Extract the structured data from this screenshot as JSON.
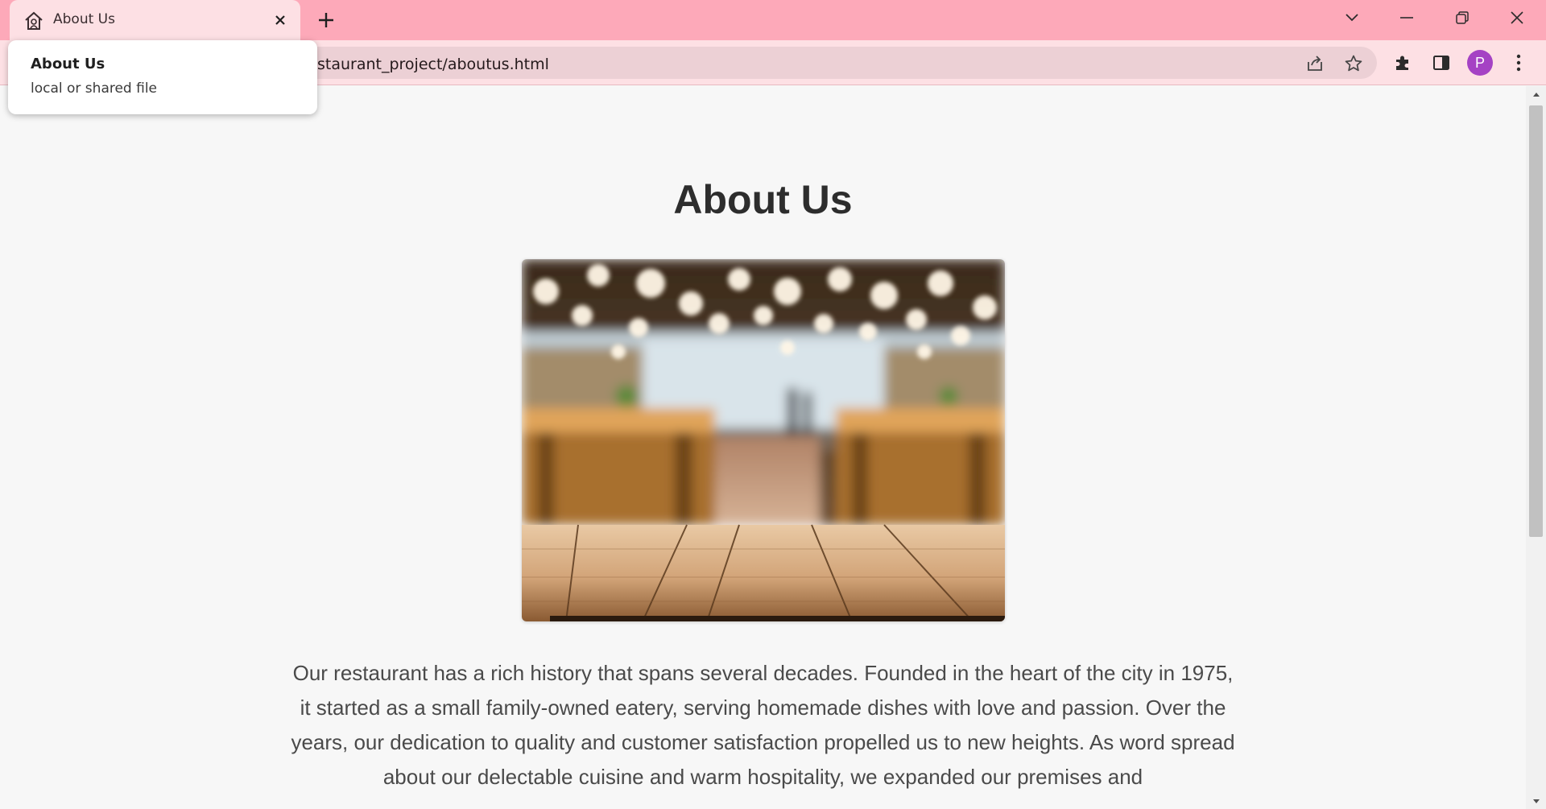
{
  "browser": {
    "tab": {
      "title": "About Us",
      "favicon": "restaurant-home-icon"
    },
    "url": "staurant_project/aboutus.html",
    "profile_initial": "P",
    "colors": {
      "tabstrip": "#fda9b9",
      "toolbar": "#fde0e4",
      "omnibox": "#ecd0d5",
      "avatar": "#a542c4"
    },
    "icons": {
      "new_tab": "plus-icon",
      "tab_search": "chevron-down-icon",
      "minimize": "minimize-icon",
      "restore": "restore-icon",
      "close": "close-icon",
      "share": "share-icon",
      "bookmark": "star-icon",
      "extensions": "puzzle-icon",
      "side_panel": "side-panel-icon",
      "menu": "kebab-menu-icon"
    }
  },
  "hovercard": {
    "title": "About Us",
    "subtitle": "local or shared file"
  },
  "page": {
    "title": "About Us",
    "hero_image": "blurred restaurant interior with wooden table in foreground",
    "history_text": "Our restaurant has a rich history that spans several decades. Founded in the heart of the city in 1975, it started as a small family-owned eatery, serving homemade dishes with love and passion. Over the years, our dedication to quality and customer satisfaction propelled us to new heights. As word spread about our delectable cuisine and warm hospitality, we expanded our premises and"
  }
}
